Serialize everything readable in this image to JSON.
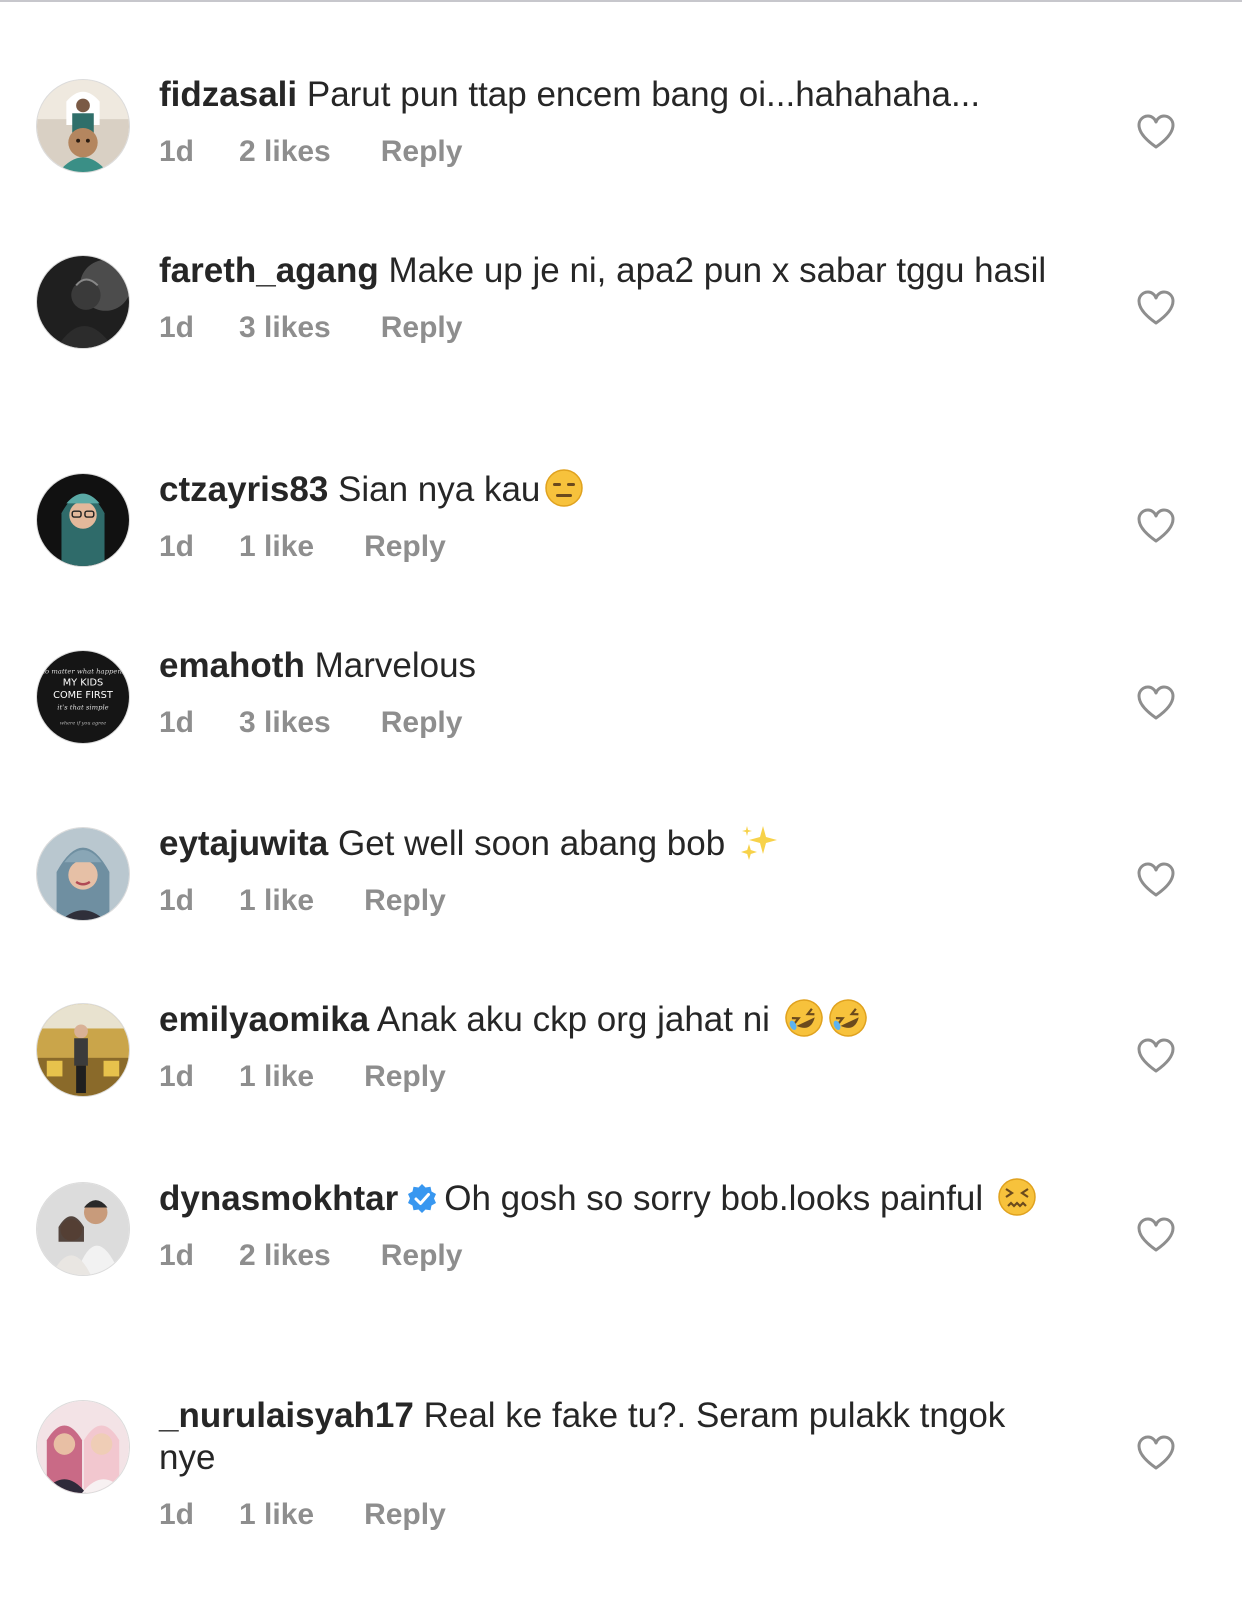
{
  "comments": [
    {
      "username": "fidzasali",
      "text": "Parut pun ttap encem bang oi...hahahaha...",
      "time": "1d",
      "likes": "2 likes",
      "reply": "Reply",
      "verified": false,
      "emoji": []
    },
    {
      "username": "fareth_agang",
      "text": "Make up je ni, apa2 pun x sabar tggu hasil",
      "time": "1d",
      "likes": "3 likes",
      "reply": "Reply",
      "verified": false,
      "emoji": []
    },
    {
      "username": "ctzayris83",
      "text": "Sian nya kau",
      "time": "1d",
      "likes": "1 like",
      "reply": "Reply",
      "verified": false,
      "emoji": [
        "expressionless-face-emoji"
      ]
    },
    {
      "username": "emahoth",
      "text": "Marvelous",
      "time": "1d",
      "likes": "3 likes",
      "reply": "Reply",
      "verified": false,
      "emoji": [],
      "avatar_text": [
        "no matter what happens",
        "MY KIDS",
        "COME FIRST",
        "it's that simple",
        "where if you agree"
      ]
    },
    {
      "username": "eytajuwita",
      "text": "Get well soon abang bob",
      "time": "1d",
      "likes": "1 like",
      "reply": "Reply",
      "verified": false,
      "emoji": [
        "sparkles-emoji"
      ]
    },
    {
      "username": "emilyaomika",
      "text": "Anak aku ckp org jahat ni",
      "time": "1d",
      "likes": "1 like",
      "reply": "Reply",
      "verified": false,
      "emoji": [
        "rofl-emoji",
        "rofl-emoji"
      ]
    },
    {
      "username": "dynasmokhtar",
      "text": "Oh gosh so sorry bob.looks painful",
      "time": "1d",
      "likes": "2 likes",
      "reply": "Reply",
      "verified": true,
      "emoji": [
        "confounded-face-emoji"
      ]
    },
    {
      "username": "_nurulaisyah17",
      "text": "Real ke fake tu?. Seram pulakk tngok nye",
      "time": "1d",
      "likes": "1 like",
      "reply": "Reply",
      "verified": false,
      "emoji": []
    }
  ],
  "colors": {
    "text": "#262626",
    "meta": "#8e8e8e",
    "verified": "#3897f0",
    "divider": "#c7c7cc"
  }
}
